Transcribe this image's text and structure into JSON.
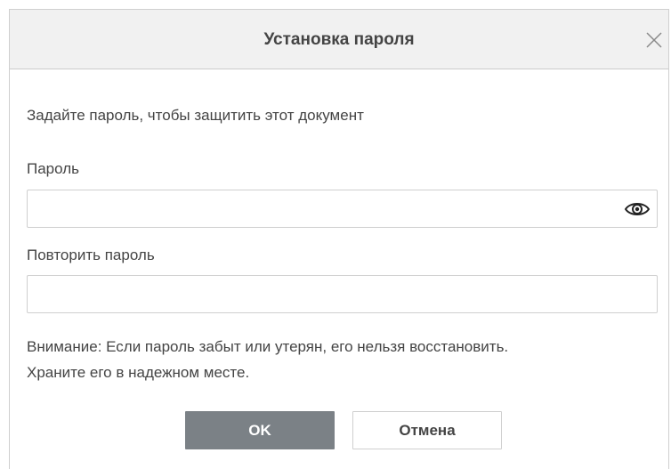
{
  "dialog": {
    "title": "Установка пароля",
    "close_icon": "close-icon",
    "description": "Задайте пароль, чтобы защитить этот документ",
    "password": {
      "label": "Пароль",
      "value": "",
      "toggle_icon": "eye-icon"
    },
    "repeat_password": {
      "label": "Повторить пароль",
      "value": ""
    },
    "warning_line1": "Внимание: Если пароль забыт или утерян, его нельзя восстановить.",
    "warning_line2": "Храните его в надежном месте.",
    "ok_label": "OK",
    "cancel_label": "Отмена"
  },
  "colors": {
    "header_bg": "#f1f1f1",
    "primary_button": "#7b8186",
    "border": "#cfcfcf",
    "text": "#444444"
  }
}
